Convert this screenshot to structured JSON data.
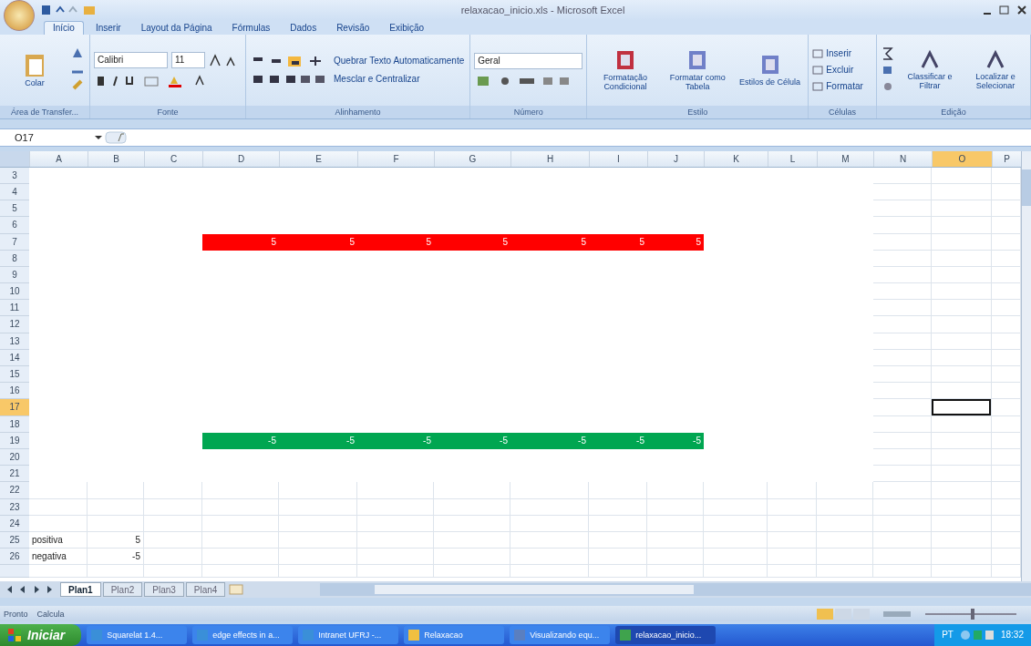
{
  "window": {
    "title": "relaxacao_inicio.xls - Microsoft Excel"
  },
  "ribbon_tabs": [
    {
      "label": "Início",
      "selected": true
    },
    {
      "label": "Inserir",
      "selected": false
    },
    {
      "label": "Layout da Página",
      "selected": false
    },
    {
      "label": "Fórmulas",
      "selected": false
    },
    {
      "label": "Dados",
      "selected": false
    },
    {
      "label": "Revisão",
      "selected": false
    },
    {
      "label": "Exibição",
      "selected": false
    }
  ],
  "ribbon": {
    "clipboard": {
      "paste": "Colar",
      "label": "Área de Transfer..."
    },
    "font": {
      "family": "Calibri",
      "size": "11",
      "label": "Fonte"
    },
    "alignment": {
      "wrap": "Quebrar Texto Automaticamente",
      "merge": "Mesclar e Centralizar",
      "label": "Alinhamento"
    },
    "number": {
      "format": "Geral",
      "label": "Número"
    },
    "styles": {
      "buttons": [
        "Formatação Condicional",
        "Formatar como Tabela",
        "Estilos de Célula"
      ],
      "label": "Estilo"
    },
    "cells": {
      "buttons": [
        "Inserir",
        "Excluir",
        "Formatar"
      ],
      "label": "Células"
    },
    "editing": {
      "buttons": [
        "Classificar e Filtrar",
        "Localizar e Selecionar"
      ],
      "label": "Edição"
    }
  },
  "formula_bar": {
    "name_box": "O17"
  },
  "sheet": {
    "columns": [
      {
        "label": "A",
        "selected": false
      },
      {
        "label": "B",
        "selected": false
      },
      {
        "label": "C",
        "selected": false
      },
      {
        "label": "D",
        "selected": false
      },
      {
        "label": "E",
        "selected": false
      },
      {
        "label": "F",
        "selected": false
      },
      {
        "label": "G",
        "selected": false
      },
      {
        "label": "H",
        "selected": false
      },
      {
        "label": "I",
        "selected": false
      },
      {
        "label": "J",
        "selected": false
      },
      {
        "label": "K",
        "selected": false
      },
      {
        "label": "L",
        "selected": false
      },
      {
        "label": "M",
        "selected": false
      },
      {
        "label": "N",
        "selected": false
      },
      {
        "label": "O",
        "selected": true
      },
      {
        "label": "P",
        "selected": false
      }
    ],
    "rows": [
      {
        "label": "3",
        "selected": false
      },
      {
        "label": "4",
        "selected": false
      },
      {
        "label": "5",
        "selected": false
      },
      {
        "label": "6",
        "selected": false
      },
      {
        "label": "7",
        "selected": false,
        "kind": "band",
        "color": "#ff0000",
        "cells": [
          "5",
          "5",
          "5",
          "5",
          "5",
          "5",
          "5"
        ]
      },
      {
        "label": "8",
        "selected": false
      },
      {
        "label": "9",
        "selected": false
      },
      {
        "label": "10",
        "selected": false
      },
      {
        "label": "11",
        "selected": false
      },
      {
        "label": "12",
        "selected": false
      },
      {
        "label": "13",
        "selected": false
      },
      {
        "label": "14",
        "selected": false
      },
      {
        "label": "15",
        "selected": false
      },
      {
        "label": "16",
        "selected": false
      },
      {
        "label": "17",
        "selected": true
      },
      {
        "label": "18",
        "selected": false
      },
      {
        "label": "19",
        "selected": false,
        "kind": "band",
        "color": "#00a651",
        "cells": [
          "-5",
          "-5",
          "-5",
          "-5",
          "-5",
          "-5",
          "-5"
        ]
      },
      {
        "label": "20",
        "selected": false
      },
      {
        "label": "21",
        "selected": false
      },
      {
        "label": "22",
        "selected": false
      },
      {
        "label": "23",
        "selected": false
      },
      {
        "label": "24",
        "selected": false
      },
      {
        "label": "25",
        "selected": false,
        "kind": "values",
        "cells": [
          "positiva",
          "5"
        ]
      },
      {
        "label": "26",
        "selected": false,
        "kind": "values",
        "cells": [
          "negativa",
          "-5"
        ]
      }
    ]
  },
  "sheet_tabs": [
    {
      "label": "Plan1",
      "selected": true
    },
    {
      "label": "Plan2",
      "selected": false
    },
    {
      "label": "Plan3",
      "selected": false
    },
    {
      "label": "Plan4",
      "selected": false
    }
  ],
  "status_bar": {
    "items": [
      "Pronto",
      "Calcula"
    ],
    "zoom": {
      "level": 0.5
    }
  },
  "taskbar": {
    "start": "Iniciar",
    "items": [
      {
        "label": "Squarelat 1.4...",
        "selected": false,
        "kind": "browser"
      },
      {
        "label": "edge effects in a...",
        "selected": false,
        "kind": "browser"
      },
      {
        "label": "Intranet UFRJ -...",
        "selected": false,
        "kind": "browser"
      },
      {
        "label": "Relaxacao",
        "selected": false,
        "kind": "folder"
      },
      {
        "label": "Visualizando equ...",
        "selected": false,
        "kind": "document"
      },
      {
        "label": "relaxacao_inicio...",
        "selected": true,
        "kind": "sheet"
      }
    ],
    "language": "PT",
    "clock": "18:32"
  }
}
